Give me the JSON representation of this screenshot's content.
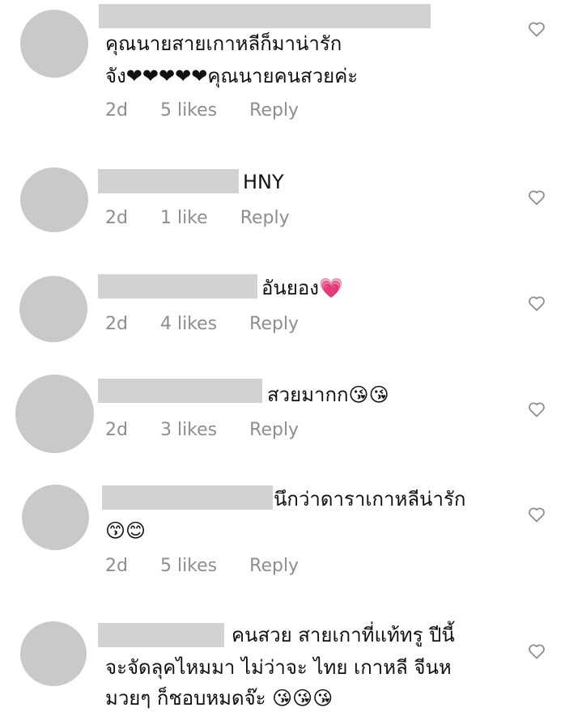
{
  "comments": [
    {
      "text_lines": [
        "คุณนายสายเกาหลีก็มาน่ารัก",
        "จัง❤❤❤❤❤คุณนายคนสวยค่ะ"
      ],
      "age": "2d",
      "likes": "5 likes",
      "reply": "Reply"
    },
    {
      "text_lines": [
        "HNY"
      ],
      "age": "2d",
      "likes": "1 like",
      "reply": "Reply"
    },
    {
      "text_lines": [
        "อันยอง💗"
      ],
      "age": "2d",
      "likes": "4 likes",
      "reply": "Reply"
    },
    {
      "text_lines": [
        "สวยมากก😘😘"
      ],
      "age": "2d",
      "likes": "3 likes",
      "reply": "Reply"
    },
    {
      "text_lines": [
        "นึกว่าดาราเกาหลีน่ารัก",
        "😙😊"
      ],
      "age": "2d",
      "likes": "5 likes",
      "reply": "Reply"
    },
    {
      "text_lines": [
        "คนสวย สายเกาที่แท้ทรู ปีนี้",
        "จะจัดลุคไหมมา ไม่ว่าจะ ไทย เกาหลี จีนห",
        "มวยๆ ก็ชอบหมดจ๊ะ 😘😘😘"
      ],
      "age": null,
      "likes": null,
      "reply": null
    }
  ],
  "icons": {
    "like": "heart-outline-icon"
  },
  "colors": {
    "avatar": "#c9c9c9",
    "name_redaction": "#d2d2d2",
    "meta": "#8e8e8e"
  }
}
